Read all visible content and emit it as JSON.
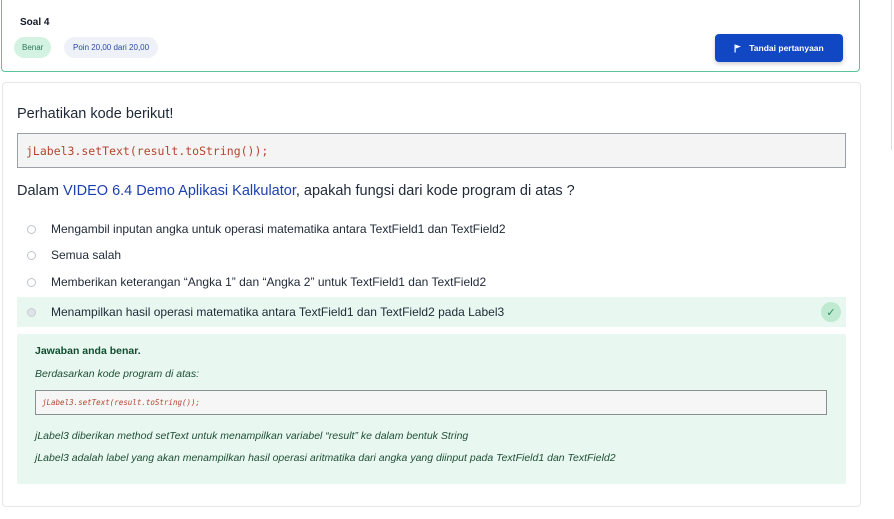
{
  "header": {
    "soal_title": "Soal 4",
    "status_badge": "Benar",
    "points_badge": "Poin 20,00 dari 20,00",
    "flag_button": "Tandai pertanyaan"
  },
  "question": {
    "intro": "Perhatikan kode berikut!",
    "code": "jLabel3.setText(result.toString());",
    "prefix": "Dalam ",
    "link_text": "VIDEO 6.4 Demo Aplikasi Kalkulator",
    "suffix": ",  apakah fungsi dari kode program di atas ?"
  },
  "options": [
    {
      "label": "Mengambil inputan angka untuk operasi matematika antara TextField1 dan TextField2"
    },
    {
      "label": "Semua salah"
    },
    {
      "label": "Memberikan keterangan “Angka 1” dan “Angka 2” untuk TextField1 dan TextField2"
    },
    {
      "label": "Menampilkan hasil operasi matematika antara TextField1 dan TextField2 pada Label3",
      "selected": true,
      "correct": true
    }
  ],
  "feedback": {
    "title": "Jawaban anda benar.",
    "subtitle": "Berdasarkan kode program di atas:",
    "code": "jLabel3.setText(result.toString());",
    "line1": "jLabel3 diberikan method setText untuk menampilkan variabel “result” ke dalam bentuk String",
    "line2": "jLabel3 adalah label yang akan menampilkan hasil operasi aritmatika dari angka yang diinput pada TextField1 dan TextField2"
  },
  "icons": {
    "flag": "flag-icon",
    "check": "check-icon"
  },
  "colors": {
    "accent_blue": "#1147c2",
    "correct_green": "#e8f7ef",
    "code_red": "#b5452f"
  }
}
